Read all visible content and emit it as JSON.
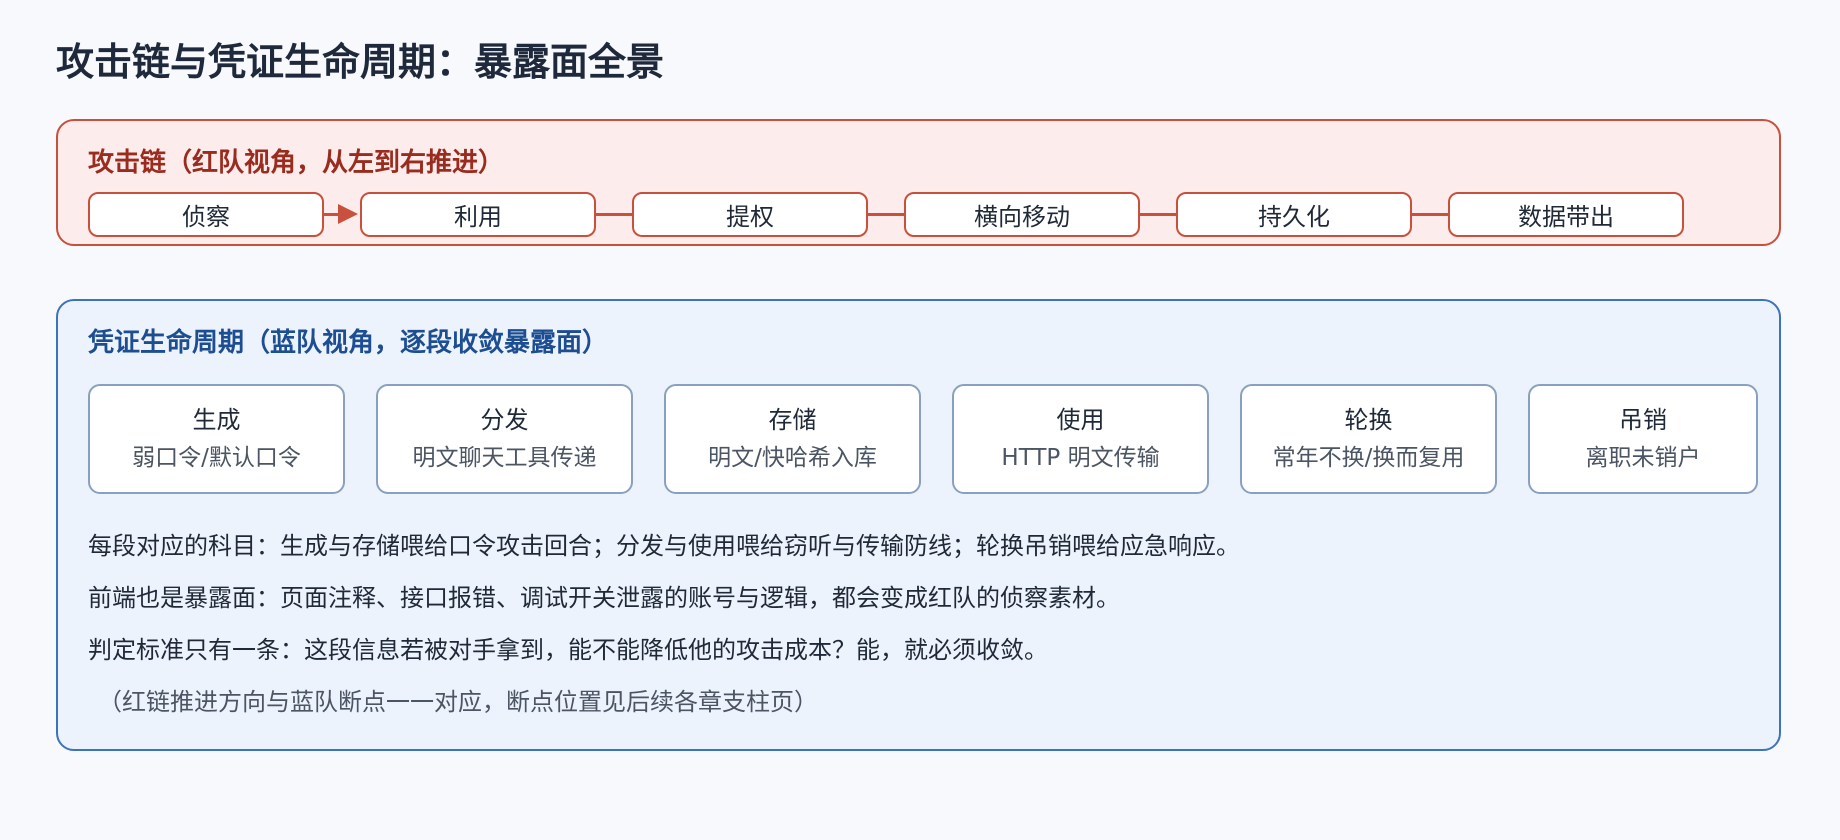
{
  "title": "攻击链与凭证生命周期：暴露面全景",
  "attack_chain": {
    "heading": "攻击链（红队视角，从左到右推进）",
    "stages": [
      "侦察",
      "利用",
      "提权",
      "横向移动",
      "持久化",
      "数据带出"
    ]
  },
  "credential_lifecycle": {
    "heading": "凭证生命周期（蓝队视角，逐段收敛暴露面）",
    "phases": [
      {
        "name": "生成",
        "risk": "弱口令/默认口令"
      },
      {
        "name": "分发",
        "risk": "明文聊天工具传递"
      },
      {
        "name": "存储",
        "risk": "明文/快哈希入库"
      },
      {
        "name": "使用",
        "risk": "HTTP 明文传输"
      },
      {
        "name": "轮换",
        "risk": "常年不换/换而复用"
      },
      {
        "name": "吊销",
        "risk": "离职未销户"
      }
    ],
    "notes": [
      "每段对应的科目：生成与存储喂给口令攻击回合；分发与使用喂给窃听与传输防线；轮换吊销喂给应急响应。",
      "前端也是暴露面：页面注释、接口报错、调试开关泄露的账号与逻辑，都会变成红队的侦察素材。",
      "判定标准只有一条：这段信息若被对手拿到，能不能降低他的攻击成本？能，就必须收敛。"
    ],
    "footnote": "（红链推进方向与蓝队断点一一对应，断点位置见后续各章支柱页）"
  },
  "colors": {
    "attack_border": "#c8503c",
    "attack_fill": "#fdecec",
    "attack_heading": "#9a2c1f",
    "lifecycle_border": "#3c73bd",
    "lifecycle_fill": "#edf3fd",
    "lifecycle_heading": "#1d4e92"
  }
}
